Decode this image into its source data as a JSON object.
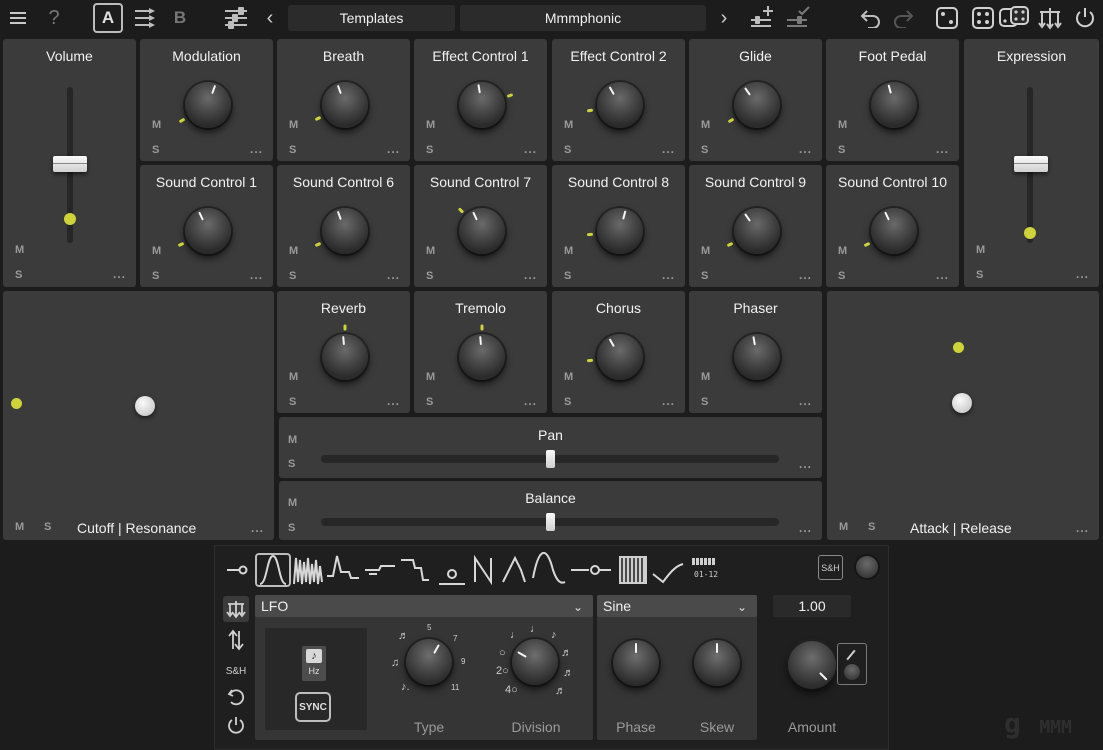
{
  "toolbar": {
    "menu_icon": "hamburger-icon",
    "help_label": "?",
    "preset_a": "A",
    "preset_b": "B",
    "copy_ab_icon": "copy-arrows-icon",
    "mixer_icon": "mixer-icon",
    "prev": "‹",
    "next": "›",
    "templates_label": "Templates",
    "preset_name": "Mmmphonic",
    "add_preset_icon": "add-slider-icon",
    "save_preset_icon": "check-slider-icon",
    "undo_icon": "undo-icon",
    "redo_icon": "redo-icon",
    "randomize_icons": [
      "dice-one-icon",
      "dice-two-icon",
      "dice-pair-icon"
    ],
    "routing_icon": "routing-icon",
    "power_icon": "power-icon"
  },
  "controls": {
    "m": "M",
    "s": "S",
    "more": "...",
    "volume": {
      "label": "Volume",
      "level": 0.6
    },
    "expression": {
      "label": "Expression",
      "level": 0.55
    },
    "knobs_row1": [
      "Modulation",
      "Breath",
      "Effect Control 1",
      "Effect Control 2",
      "Glide",
      "Foot Pedal"
    ],
    "knobs_row2": [
      "Sound Control 1",
      "Sound Control 6",
      "Sound Control 7",
      "Sound Control 8",
      "Sound Control 9",
      "Sound Control 10"
    ],
    "knobs_row3": [
      "Reverb",
      "Tremolo",
      "Chorus",
      "Phaser"
    ],
    "pan": {
      "label": "Pan",
      "value": 0.5
    },
    "balance": {
      "label": "Balance",
      "value": 0.5
    },
    "xy_left": {
      "label": "Cutoff | Resonance"
    },
    "xy_right": {
      "label": "Attack | Release"
    }
  },
  "modulator": {
    "shapes": [
      "connect-icon",
      "sine-bell-icon",
      "noise-icon",
      "envelope-icon",
      "step-icon",
      "ramp-step-icon",
      "point-icon",
      "zigzag-icon",
      "triangle-icon",
      "sine-icon",
      "line-point-icon",
      "random-icon",
      "check-curve-icon",
      "steps-01-12-icon"
    ],
    "steps_label": "01-12",
    "sh_label": "S&H",
    "source": "LFO",
    "waveform": "Sine",
    "amount_value": "1.00",
    "rate_icon_label": "Hz",
    "sync_label": "SYNC",
    "type_label": "Type",
    "division_label": "Division",
    "phase_label": "Phase",
    "skew_label": "Skew",
    "amount_label": "Amount",
    "type_ticks": [
      "5",
      "7",
      "9",
      "11"
    ],
    "side_icons": [
      "routing-icon",
      "updown-icon",
      "sh-icon",
      "reset-icon",
      "power-icon"
    ],
    "side_sh": "S&H"
  },
  "brand": {
    "logo_text": "MMM"
  }
}
